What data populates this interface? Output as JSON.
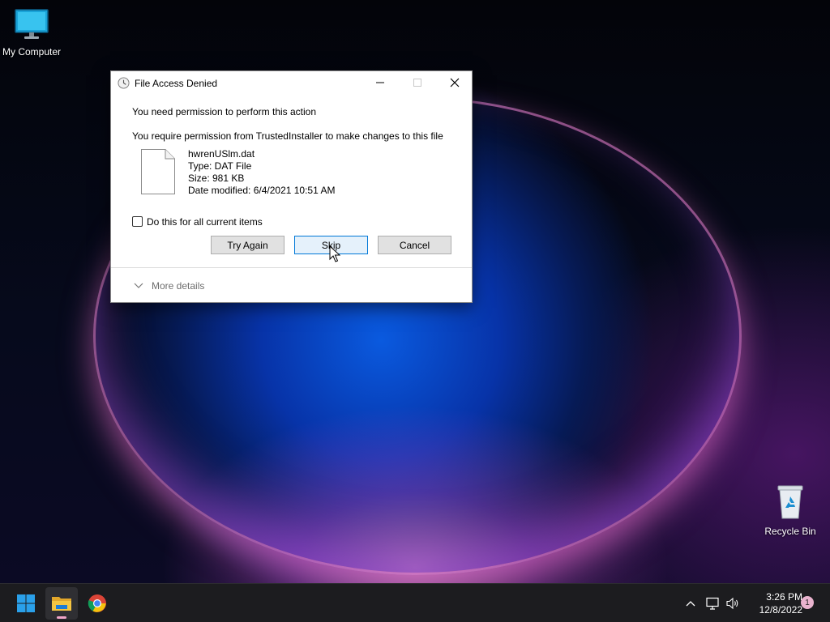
{
  "desktop": {
    "icons": [
      {
        "label": "My Computer",
        "icon": "monitor-icon"
      },
      {
        "label": "Recycle Bin",
        "icon": "recycle-bin-icon"
      }
    ]
  },
  "dialog": {
    "title": "File Access Denied",
    "message": "You need permission to perform this action",
    "permission_text": "You require permission from TrustedInstaller to make changes to this file",
    "file": {
      "name": "hwrenUSlm.dat",
      "type": "Type: DAT File",
      "size": "Size: 981 KB",
      "modified": "Date modified: 6/4/2021 10:51 AM"
    },
    "checkbox_label": "Do this for all current items",
    "checkbox_checked": false,
    "buttons": {
      "try_again": "Try Again",
      "skip": "Skip",
      "cancel": "Cancel"
    },
    "more_details": "More details"
  },
  "taskbar": {
    "apps": [
      {
        "icon": "windows-start-icon"
      },
      {
        "icon": "file-explorer-icon",
        "active": true
      },
      {
        "icon": "chrome-icon"
      }
    ],
    "clock": {
      "time": "3:26 PM",
      "date": "12/8/2022"
    },
    "notification_count": "1"
  },
  "colors": {
    "accent": "#0078d7",
    "taskbar_bg": "#1c1c1f",
    "dialog_bg": "#ffffff"
  }
}
